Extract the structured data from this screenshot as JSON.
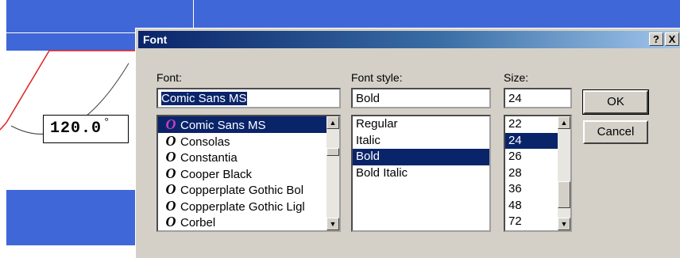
{
  "canvas": {
    "angle_value": "120.0",
    "angle_unit": "°"
  },
  "dialog": {
    "title": "Font",
    "help_button": "?",
    "close_button": "X",
    "font": {
      "label": "Font:",
      "value": "Comic Sans MS",
      "items": [
        "Comic Sans MS",
        "Consolas",
        "Constantia",
        "Cooper Black",
        "Copperplate Gothic Bol",
        "Copperplate Gothic Ligl",
        "Corbel"
      ],
      "selected_index": 0
    },
    "style": {
      "label": "Font style:",
      "value": "Bold",
      "items": [
        "Regular",
        "Italic",
        "Bold",
        "Bold Italic"
      ],
      "selected_index": 2
    },
    "size": {
      "label": "Size:",
      "value": "24",
      "items": [
        "22",
        "24",
        "26",
        "28",
        "36",
        "48",
        "72"
      ],
      "selected_index": 1
    },
    "ok_label": "OK",
    "cancel_label": "Cancel"
  },
  "icons": {
    "font_type_icon": "truetype-o-icon",
    "scroll_up": "up-arrow-icon",
    "scroll_down": "down-arrow-icon"
  },
  "colors": {
    "background_blue": "#3f67d8",
    "selection": "#0a246a",
    "dialog_face": "#d4d0c8"
  }
}
